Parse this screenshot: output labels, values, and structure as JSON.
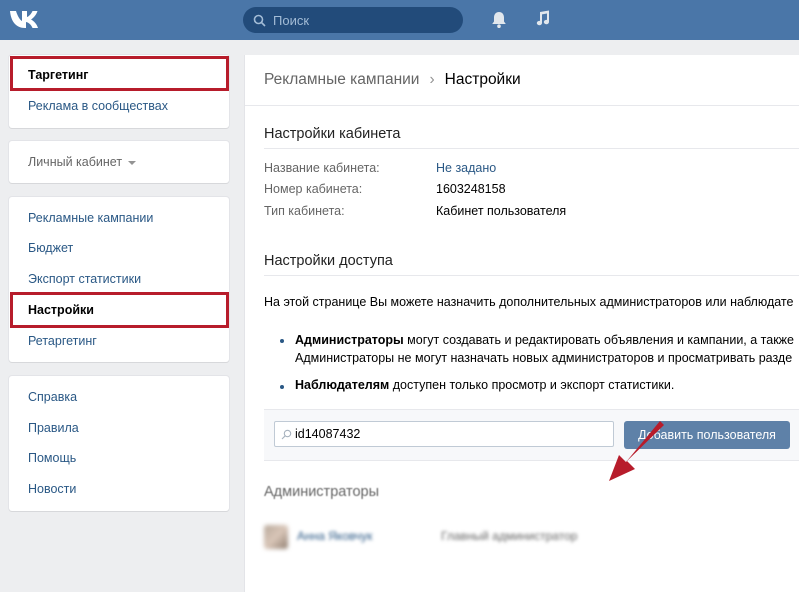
{
  "header": {
    "logo": "vk-logo",
    "search_placeholder": "Поиск",
    "icons": [
      "search-icon",
      "bell-icon",
      "music-icon"
    ],
    "color": "#4a76a8"
  },
  "sidebar": {
    "group1": [
      {
        "label": "Таргетинг",
        "active": true
      },
      {
        "label": "Реклама в сообществах"
      }
    ],
    "group2": {
      "label": "Личный кабинет"
    },
    "group3": [
      {
        "label": "Рекламные кампании"
      },
      {
        "label": "Бюджет"
      },
      {
        "label": "Экспорт статистики"
      },
      {
        "label": "Настройки",
        "active": true
      },
      {
        "label": "Ретаргетинг"
      }
    ],
    "group4": [
      {
        "label": "Справка"
      },
      {
        "label": "Правила"
      },
      {
        "label": "Помощь"
      },
      {
        "label": "Новости"
      }
    ]
  },
  "breadcrumb": {
    "parent": "Рекламные кампании",
    "separator": "›",
    "current": "Настройки"
  },
  "cabinet_settings": {
    "title": "Настройки кабинета",
    "rows": [
      {
        "label": "Название кабинета:",
        "value": "Не задано"
      },
      {
        "label": "Номер кабинета:",
        "value": "1603248158"
      },
      {
        "label": "Тип кабинета:",
        "value": "Кабинет пользователя"
      }
    ]
  },
  "access_settings": {
    "title": "Настройки доступа",
    "intro": "На этой странице Вы можете назначить дополнительных администраторов или наблюдате",
    "bullet1_bold": "Администраторы",
    "bullet1_text": " могут создавать и редактировать объявления и кампании, а также",
    "bullet1_line2": "Администраторы не могут назначать новых администраторов и просматривать разде",
    "bullet2_bold": "Наблюдателям",
    "bullet2_text": " доступен только просмотр и экспорт статистики.",
    "input_value": "id14087432",
    "add_button": "Добавить пользователя"
  },
  "admins": {
    "title": "Администраторы",
    "rows": [
      {
        "name": "Анна Яковчук",
        "role": "Главный администратор"
      }
    ]
  },
  "colors": {
    "accent": "#4a76a8",
    "link": "#2a5885",
    "highlight_box": "#b71c2b",
    "button": "#5e81a8"
  }
}
